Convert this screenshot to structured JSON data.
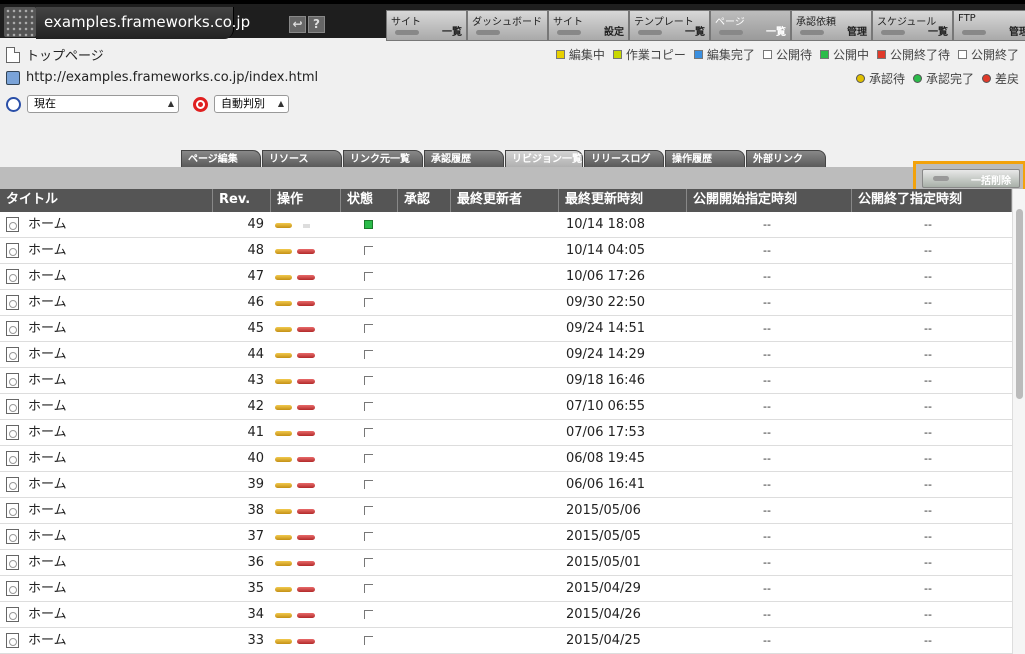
{
  "header": {
    "site_title": "examples.frameworks.co.jp",
    "help_icon": "?",
    "menu": [
      {
        "top": "サイト",
        "bottom": "一覧"
      },
      {
        "top": "ダッシュボード",
        "bottom": ""
      },
      {
        "top": "サイト",
        "bottom": "設定"
      },
      {
        "top": "テンプレート",
        "bottom": "一覧"
      },
      {
        "top": "ページ",
        "bottom": "一覧"
      },
      {
        "top": "承認依頼",
        "bottom": "管理"
      },
      {
        "top": "スケジュール",
        "bottom": "一覧"
      },
      {
        "top": "FTP",
        "bottom": "管理"
      }
    ]
  },
  "page": {
    "name": "トップページ",
    "url": "http://examples.frameworks.co.jp/index.html",
    "time_select": "現在",
    "judge_select": "自動判別"
  },
  "legend_status": [
    {
      "label": "編集中",
      "color": "#e8d000"
    },
    {
      "label": "作業コピー",
      "color": "#c8d800"
    },
    {
      "label": "編集完了",
      "color": "#3a8fe0"
    },
    {
      "label": "公開待",
      "color": "#ffffff"
    },
    {
      "label": "公開中",
      "color": "#2bbb4a"
    },
    {
      "label": "公開終了待",
      "color": "#e03a2a"
    },
    {
      "label": "公開終了",
      "color": "#ffffff"
    }
  ],
  "legend_approval": [
    {
      "label": "承認待",
      "color": "#e0c000"
    },
    {
      "label": "承認完了",
      "color": "#2bbb4a"
    },
    {
      "label": "差戻",
      "color": "#e03a2a"
    }
  ],
  "tabs": [
    {
      "label": "ページ編集",
      "width": 80
    },
    {
      "label": "リソース",
      "width": 80
    },
    {
      "label": "リンク元一覧",
      "width": 80
    },
    {
      "label": "承認履歴",
      "width": 80
    },
    {
      "label": "リビジョン一覧",
      "width": 78,
      "active": true
    },
    {
      "label": "リリースログ",
      "width": 80
    },
    {
      "label": "操作履歴",
      "width": 80
    },
    {
      "label": "外部リンク",
      "width": 80
    }
  ],
  "bulk_delete_label": "一括削除",
  "columns": [
    {
      "label": "タイトル"
    },
    {
      "label": "Rev."
    },
    {
      "label": "操作"
    },
    {
      "label": "状態"
    },
    {
      "label": "承認"
    },
    {
      "label": "最終更新者"
    },
    {
      "label": "最終更新時刻"
    },
    {
      "label": "公開開始指定時刻"
    },
    {
      "label": "公開終了指定時刻"
    }
  ],
  "rows": [
    {
      "title": "ホーム",
      "rev": "49",
      "date": "10/14 18:08",
      "start": "--",
      "end": "--",
      "current": true
    },
    {
      "title": "ホーム",
      "rev": "48",
      "date": "10/14 04:05",
      "start": "--",
      "end": "--"
    },
    {
      "title": "ホーム",
      "rev": "47",
      "date": "10/06 17:26",
      "start": "--",
      "end": "--"
    },
    {
      "title": "ホーム",
      "rev": "46",
      "date": "09/30 22:50",
      "start": "--",
      "end": "--"
    },
    {
      "title": "ホーム",
      "rev": "45",
      "date": "09/24 14:51",
      "start": "--",
      "end": "--"
    },
    {
      "title": "ホーム",
      "rev": "44",
      "date": "09/24 14:29",
      "start": "--",
      "end": "--"
    },
    {
      "title": "ホーム",
      "rev": "43",
      "date": "09/18 16:46",
      "start": "--",
      "end": "--"
    },
    {
      "title": "ホーム",
      "rev": "42",
      "date": "07/10 06:55",
      "start": "--",
      "end": "--"
    },
    {
      "title": "ホーム",
      "rev": "41",
      "date": "07/06 17:53",
      "start": "--",
      "end": "--"
    },
    {
      "title": "ホーム",
      "rev": "40",
      "date": "06/08 19:45",
      "start": "--",
      "end": "--"
    },
    {
      "title": "ホーム",
      "rev": "39",
      "date": "06/06 16:41",
      "start": "--",
      "end": "--"
    },
    {
      "title": "ホーム",
      "rev": "38",
      "date": "2015/05/06",
      "start": "--",
      "end": "--"
    },
    {
      "title": "ホーム",
      "rev": "37",
      "date": "2015/05/05",
      "start": "--",
      "end": "--"
    },
    {
      "title": "ホーム",
      "rev": "36",
      "date": "2015/05/01",
      "start": "--",
      "end": "--"
    },
    {
      "title": "ホーム",
      "rev": "35",
      "date": "2015/04/29",
      "start": "--",
      "end": "--"
    },
    {
      "title": "ホーム",
      "rev": "34",
      "date": "2015/04/26",
      "start": "--",
      "end": "--"
    },
    {
      "title": "ホーム",
      "rev": "33",
      "date": "2015/04/25",
      "start": "--",
      "end": "--"
    }
  ]
}
